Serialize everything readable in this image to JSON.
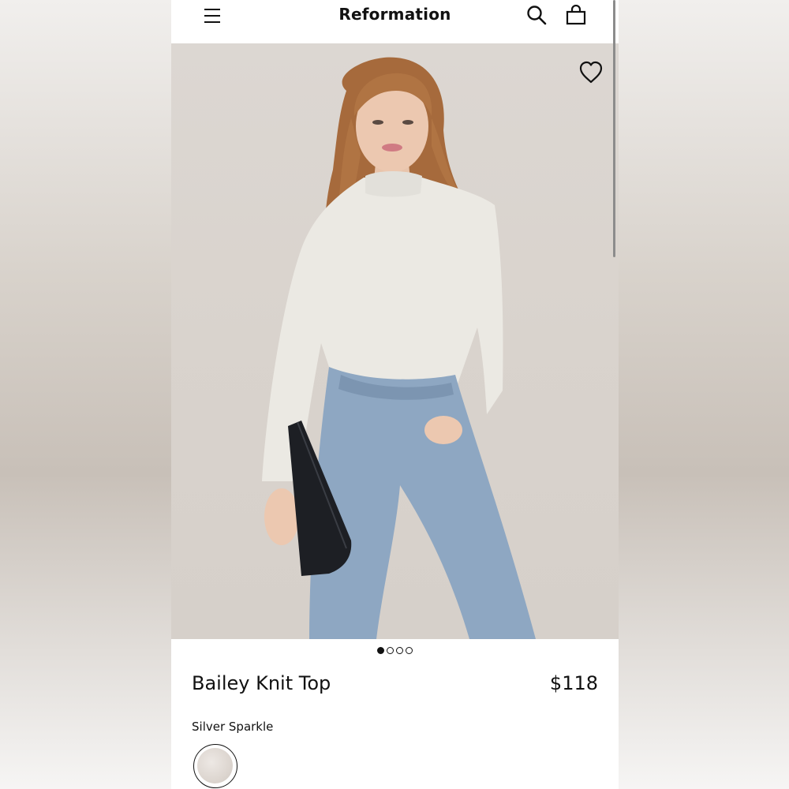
{
  "header": {
    "brand": "Reformation",
    "menu_icon": "hamburger-menu-icon",
    "search_icon": "search-icon",
    "bag_icon": "shopping-bag-icon"
  },
  "gallery": {
    "favorite_icon": "heart-icon",
    "image_count": 4,
    "active_index": 0
  },
  "product": {
    "name": "Bailey Knit Top",
    "price": "$118",
    "color": "Silver Sparkle"
  },
  "colors": {
    "swatch": "#e3ddd7",
    "text": "#111111",
    "photo_bg": "#d9d3cd"
  }
}
